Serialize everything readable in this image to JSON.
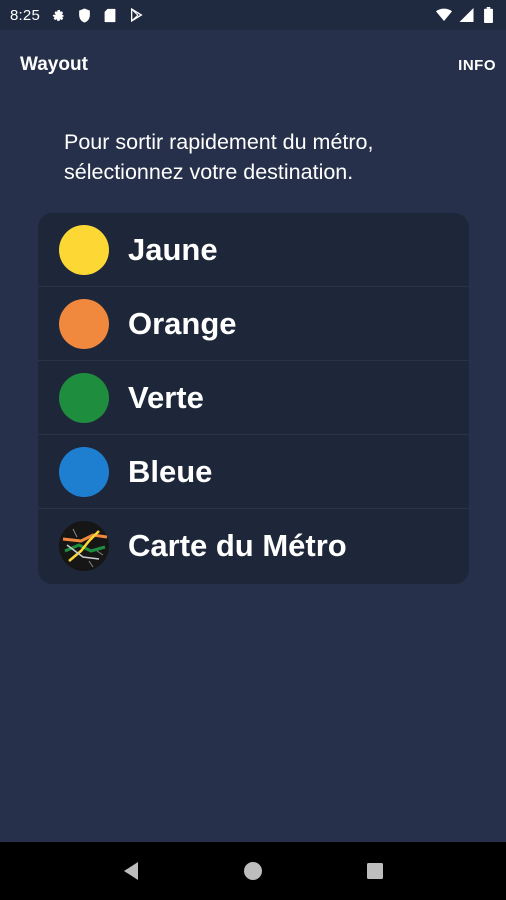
{
  "status_bar": {
    "time": "8:25",
    "left_icons": [
      "gear-icon",
      "shield-icon",
      "sd-card-icon",
      "play-store-icon"
    ],
    "right_icons": [
      "wifi-icon",
      "signal-icon",
      "battery-icon"
    ]
  },
  "app_bar": {
    "title": "Wayout",
    "info_label": "INFO"
  },
  "intro": {
    "line1": "Pour sortir rapidement du métro,",
    "line2": "sélectionnez votre destination."
  },
  "destinations": [
    {
      "label": "Jaune",
      "color": "#fdd835"
    },
    {
      "label": "Orange",
      "color": "#f0883e"
    },
    {
      "label": "Verte",
      "color": "#1e8e3e"
    },
    {
      "label": "Bleue",
      "color": "#1e7fd0"
    },
    {
      "label": "Carte du Métro",
      "icon": "metro-map-icon"
    }
  ],
  "nav_bar": {
    "icons": [
      "back-icon",
      "home-icon",
      "recents-icon"
    ]
  },
  "colors": {
    "background": "#26304a",
    "card": "#1e273a",
    "status_bar": "#1f2940",
    "nav_bar": "#000000"
  }
}
